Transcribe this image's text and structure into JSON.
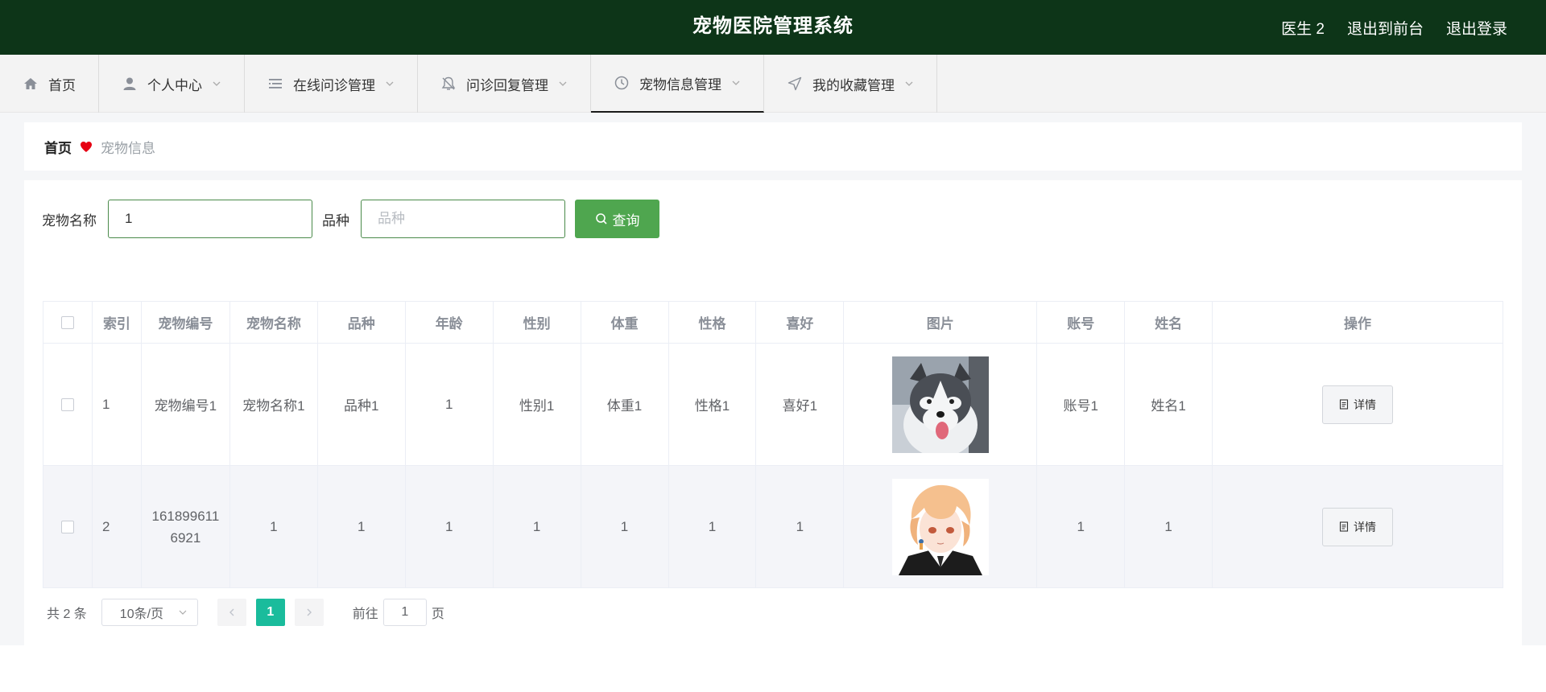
{
  "header": {
    "title": "宠物医院管理系统",
    "user": "医生 2",
    "to_front": "退出到前台",
    "logout": "退出登录",
    "bg_color": "#0d3518"
  },
  "nav": {
    "items": [
      {
        "label": "首页",
        "icon": "home-icon",
        "has_dropdown": false
      },
      {
        "label": "个人中心",
        "icon": "user-icon",
        "has_dropdown": true
      },
      {
        "label": "在线问诊管理",
        "icon": "list-icon",
        "has_dropdown": true
      },
      {
        "label": "问诊回复管理",
        "icon": "bell-off-icon",
        "has_dropdown": true
      },
      {
        "label": "宠物信息管理",
        "icon": "clock-icon",
        "has_dropdown": true,
        "active": true
      },
      {
        "label": "我的收藏管理",
        "icon": "send-icon",
        "has_dropdown": true
      }
    ]
  },
  "breadcrumb": {
    "home": "首页",
    "current": "宠物信息"
  },
  "search": {
    "name_label": "宠物名称",
    "name_value": "1",
    "breed_label": "品种",
    "breed_placeholder": "品种",
    "button": "查询",
    "button_color": "#4fa64f"
  },
  "table": {
    "headers": [
      "索引",
      "宠物编号",
      "宠物名称",
      "品种",
      "年龄",
      "性别",
      "体重",
      "性格",
      "喜好",
      "图片",
      "账号",
      "姓名",
      "操作"
    ],
    "rows": [
      {
        "index": "1",
        "code": "宠物编号1",
        "name": "宠物名称1",
        "breed": "品种1",
        "age": "1",
        "gender": "性别1",
        "weight": "体重1",
        "character": "性格1",
        "hobby": "喜好1",
        "image": "husky-dog",
        "account": "账号1",
        "realname": "姓名1",
        "action": "详情"
      },
      {
        "index": "2",
        "code": "1618996116921",
        "name": "1",
        "breed": "1",
        "age": "1",
        "gender": "1",
        "weight": "1",
        "character": "1",
        "hobby": "1",
        "image": "anime-boy",
        "account": "1",
        "realname": "1",
        "action": "详情"
      }
    ]
  },
  "pagination": {
    "total": "共 2 条",
    "page_size": "10条/页",
    "current_page": "1",
    "goto_prefix": "前往",
    "goto_value": "1",
    "goto_suffix": "页",
    "active_color": "#1abc9c"
  }
}
